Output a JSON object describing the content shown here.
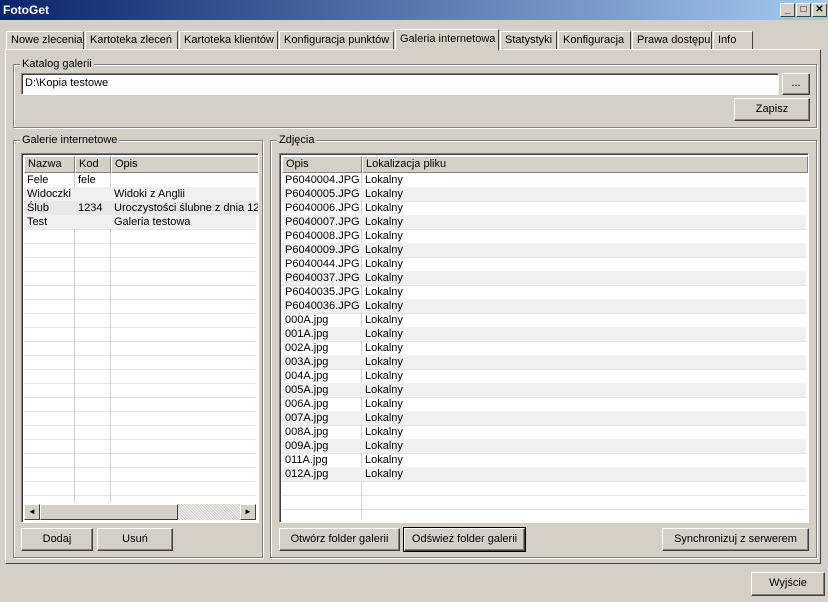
{
  "window": {
    "title": "FotoGet",
    "minimize": "_",
    "maximize": "□",
    "close": "✕"
  },
  "tabs": [
    {
      "label": "Nowe zlecenia"
    },
    {
      "label": "Kartoteka zleceń"
    },
    {
      "label": "Kartoteka klientów"
    },
    {
      "label": "Konfiguracja punktów"
    },
    {
      "label": "Galeria internetowa",
      "active": true
    },
    {
      "label": "Statystyki"
    },
    {
      "label": "Konfiguracja"
    },
    {
      "label": "Prawa dostępu"
    },
    {
      "label": "Info"
    }
  ],
  "katalog": {
    "legend": "Katalog galerii",
    "path": "D:\\Kopia testowe",
    "browse_label": "...",
    "save_label": "Zapisz"
  },
  "galleries": {
    "legend": "Galerie internetowe",
    "columns": [
      "Nazwa",
      "Kod",
      "Opis"
    ],
    "rows": [
      [
        "Fele",
        "fele",
        ""
      ],
      [
        "Widoczki",
        "",
        "Widoki z Anglii"
      ],
      [
        "Ślub",
        "1234",
        "Uroczystości ślubne z dnia 12."
      ],
      [
        "Test",
        "",
        "Galeria testowa"
      ]
    ],
    "add_label": "Dodaj",
    "remove_label": "Usuń"
  },
  "photos": {
    "legend": "Zdjęcia",
    "columns": [
      "Opis",
      "Lokalizacja pliku"
    ],
    "rows": [
      [
        "P6040004.JPG",
        "Lokalny"
      ],
      [
        "P6040005.JPG",
        "Lokalny"
      ],
      [
        "P6040006.JPG",
        "Lokalny"
      ],
      [
        "P6040007.JPG",
        "Lokalny"
      ],
      [
        "P6040008.JPG",
        "Lokalny"
      ],
      [
        "P6040009.JPG",
        "Lokalny"
      ],
      [
        "P6040044.JPG",
        "Lokalny"
      ],
      [
        "P6040037.JPG",
        "Lokalny"
      ],
      [
        "P6040035.JPG",
        "Lokalny"
      ],
      [
        "P6040036.JPG",
        "Lokalny"
      ],
      [
        "000A.jpg",
        "Lokalny"
      ],
      [
        "001A.jpg",
        "Lokalny"
      ],
      [
        "002A.jpg",
        "Lokalny"
      ],
      [
        "003A.jpg",
        "Lokalny"
      ],
      [
        "004A.jpg",
        "Lokalny"
      ],
      [
        "005A.jpg",
        "Lokalny"
      ],
      [
        "006A.jpg",
        "Lokalny"
      ],
      [
        "007A.jpg",
        "Lokalny"
      ],
      [
        "008A.jpg",
        "Lokalny"
      ],
      [
        "009A.jpg",
        "Lokalny"
      ],
      [
        "011A.jpg",
        "Lokalny"
      ],
      [
        "012A.jpg",
        "Lokalny"
      ]
    ],
    "open_folder_label": "Otwórz folder galerii",
    "refresh_folder_label": "Odśwież folder galerii",
    "sync_label": "Synchronizuj z serwerem"
  },
  "footer": {
    "exit_label": "Wyjście"
  }
}
